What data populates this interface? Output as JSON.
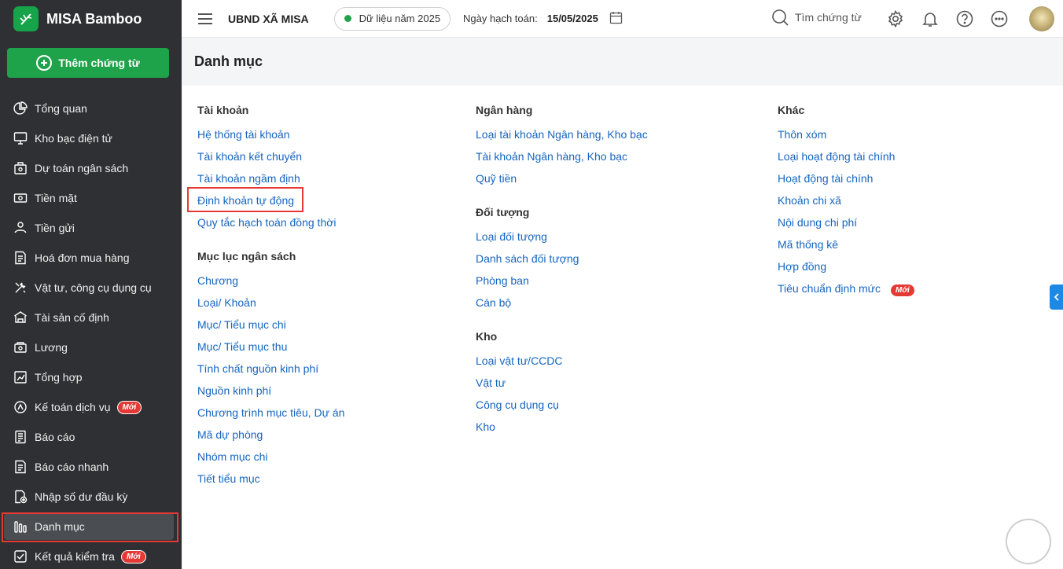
{
  "brand": {
    "name": "MISA Bamboo"
  },
  "sidebar": {
    "add_button": "Thêm chứng từ",
    "items": [
      {
        "label": "Tổng quan",
        "icon": "pie-chart-icon"
      },
      {
        "label": "Kho bạc điện tử",
        "icon": "monitor-icon"
      },
      {
        "label": "Dự toán ngân sách",
        "icon": "budget-icon"
      },
      {
        "label": "Tiền mặt",
        "icon": "cash-icon"
      },
      {
        "label": "Tiền gửi",
        "icon": "deposit-icon"
      },
      {
        "label": "Hoá đơn mua hàng",
        "icon": "invoice-icon"
      },
      {
        "label": "Vật tư, công cụ dụng cụ",
        "icon": "tools-icon"
      },
      {
        "label": "Tài sản cố định",
        "icon": "building-icon"
      },
      {
        "label": "Lương",
        "icon": "salary-icon"
      },
      {
        "label": "Tổng hợp",
        "icon": "summary-icon"
      },
      {
        "label": "Kế toán dịch vụ",
        "icon": "service-icon",
        "badge": "Mới"
      },
      {
        "label": "Báo cáo",
        "icon": "report-icon"
      },
      {
        "label": "Báo cáo nhanh",
        "icon": "quick-report-icon"
      },
      {
        "label": "Nhập số dư đầu kỳ",
        "icon": "opening-balance-icon"
      },
      {
        "label": "Danh mục",
        "icon": "catalog-icon",
        "active": true
      },
      {
        "label": "Kết quả kiểm tra",
        "icon": "check-result-icon",
        "badge": "Mới"
      }
    ]
  },
  "topbar": {
    "org": "UBND XÃ MISA",
    "year": "Dữ liệu năm 2025",
    "date_label": "Ngày hạch toán:",
    "date_value": "15/05/2025",
    "search_label": "Tìm chứng từ"
  },
  "page": {
    "title": "Danh mục"
  },
  "catalog": {
    "tai_khoan": {
      "title": "Tài khoản",
      "links": [
        "Hệ thống tài khoản",
        "Tài khoản kết chuyển",
        "Tài khoản ngầm định",
        "Định khoản tự động",
        "Quy tắc hạch toán đồng thời"
      ]
    },
    "muc_luc": {
      "title": "Mục lục ngân sách",
      "links": [
        "Chương",
        "Loại/ Khoản",
        "Mục/ Tiểu mục chi",
        "Mục/ Tiểu mục thu",
        "Tính chất nguồn kinh phí",
        "Nguồn kinh phí",
        "Chương trình mục tiêu, Dự án",
        "Mã dự phòng",
        "Nhóm mục chi",
        "Tiết tiểu mục"
      ]
    },
    "ngan_hang": {
      "title": "Ngân hàng",
      "links": [
        "Loại tài khoản Ngân hàng, Kho bạc",
        "Tài khoản Ngân hàng, Kho bạc",
        "Quỹ tiền"
      ]
    },
    "doi_tuong": {
      "title": "Đối tượng",
      "links": [
        "Loại đối tượng",
        "Danh sách đối tượng",
        "Phòng ban",
        "Cán bộ"
      ]
    },
    "kho": {
      "title": "Kho",
      "links": [
        "Loại vật tư/CCDC",
        "Vật tư",
        "Công cụ dụng cụ",
        "Kho"
      ]
    },
    "khac": {
      "title": "Khác",
      "links": [
        "Thôn xóm",
        "Loại hoạt động tài chính",
        "Hoạt động tài chính",
        "Khoản chi xã",
        "Nội dung chi phí",
        "Mã thống kê",
        "Hợp đồng",
        "Tiêu chuẩn định mức"
      ],
      "badge": "Mới"
    }
  },
  "colors": {
    "brand_green": "#1fa34a",
    "link": "#1565c0",
    "sidebar_bg": "#2e3034",
    "highlight": "#e53935"
  }
}
